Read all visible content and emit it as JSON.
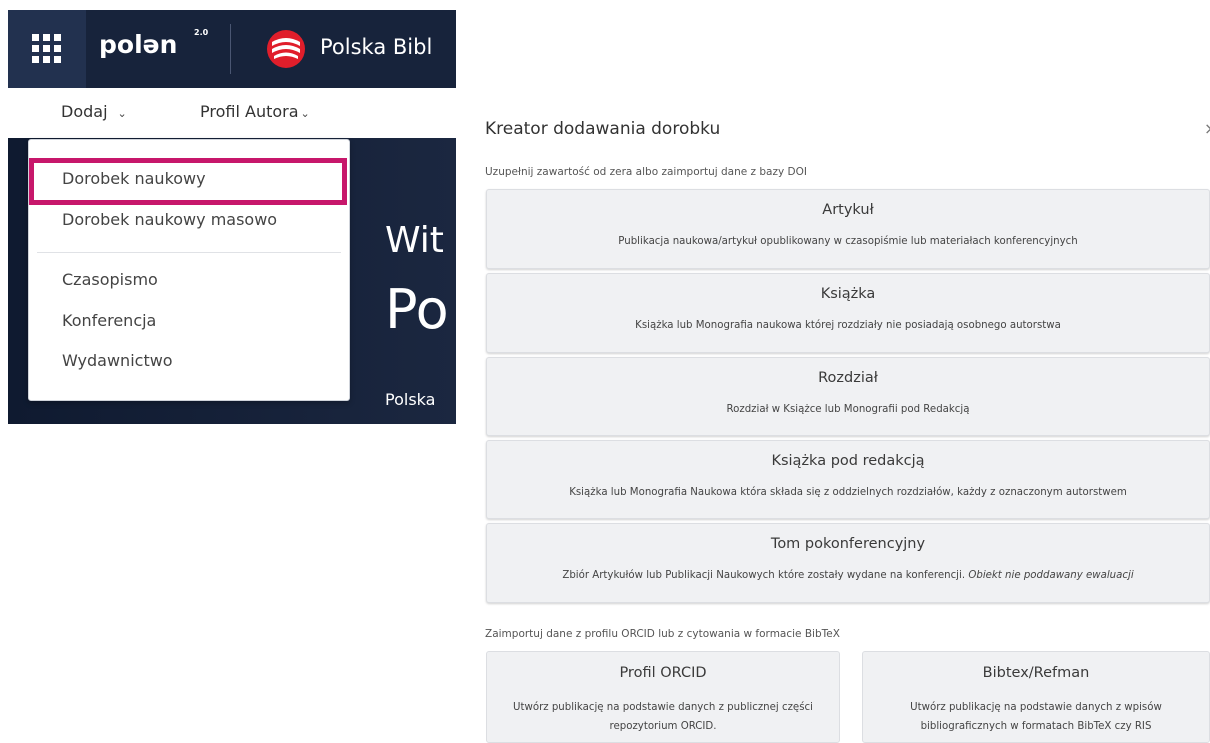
{
  "app": {
    "logo_text": "polən",
    "logo_version": "2.0",
    "library_name": "Polska Bibl"
  },
  "nav": {
    "add_label": "Dodaj",
    "author_profile_label": "Profil Autora"
  },
  "dropdown": {
    "items": [
      "Dorobek naukowy",
      "Dorobek naukowy masowo",
      "Czasopismo",
      "Konferencja",
      "Wydawnictwo"
    ]
  },
  "hero": {
    "line1": "Wit",
    "line2": "Po",
    "line3": "Polska"
  },
  "wizard": {
    "title": "Kreator dodawania dorobku",
    "close": "×",
    "section1_label": "Uzupełnij zawartość od zera albo zaimportuj dane z bazy DOI",
    "cards": [
      {
        "title": "Artykuł",
        "desc": "Publikacja naukowa/artykuł opublikowany w czasopiśmie lub materiałach konferencyjnych"
      },
      {
        "title": "Książka",
        "desc": "Książka lub Monografia naukowa której rozdziały nie posiadają osobnego autorstwa"
      },
      {
        "title": "Rozdział",
        "desc": "Rozdział w Książce lub Monografii pod Redakcją"
      },
      {
        "title": "Książka pod redakcją",
        "desc": "Książka lub Monografia Naukowa która składa się z oddzielnych rozdziałów, każdy z oznaczonym autorstwem"
      },
      {
        "title": "Tom pokonferencyjny",
        "desc": "Zbiór Artykułów lub Publikacji Naukowych które zostały wydane na konferencji.",
        "note": "Obiekt nie poddawany ewaluacji"
      }
    ],
    "section2_label": "Zaimportuj dane z profilu ORCID lub z cytowania w formacie BibTeX",
    "import_cards": [
      {
        "title": "Profil ORCID",
        "desc": "Utwórz publikację na podstawie danych z publicznej części repozytorium ORCID."
      },
      {
        "title": "Bibtex/Refman",
        "desc": "Utwórz publikację na podstawie danych z wpisów bibliograficznych w formatach BibTeX czy RIS"
      }
    ]
  },
  "colors": {
    "topbar": "#17233b",
    "highlight": "#c7176b",
    "card_bg": "#f0f1f3"
  }
}
